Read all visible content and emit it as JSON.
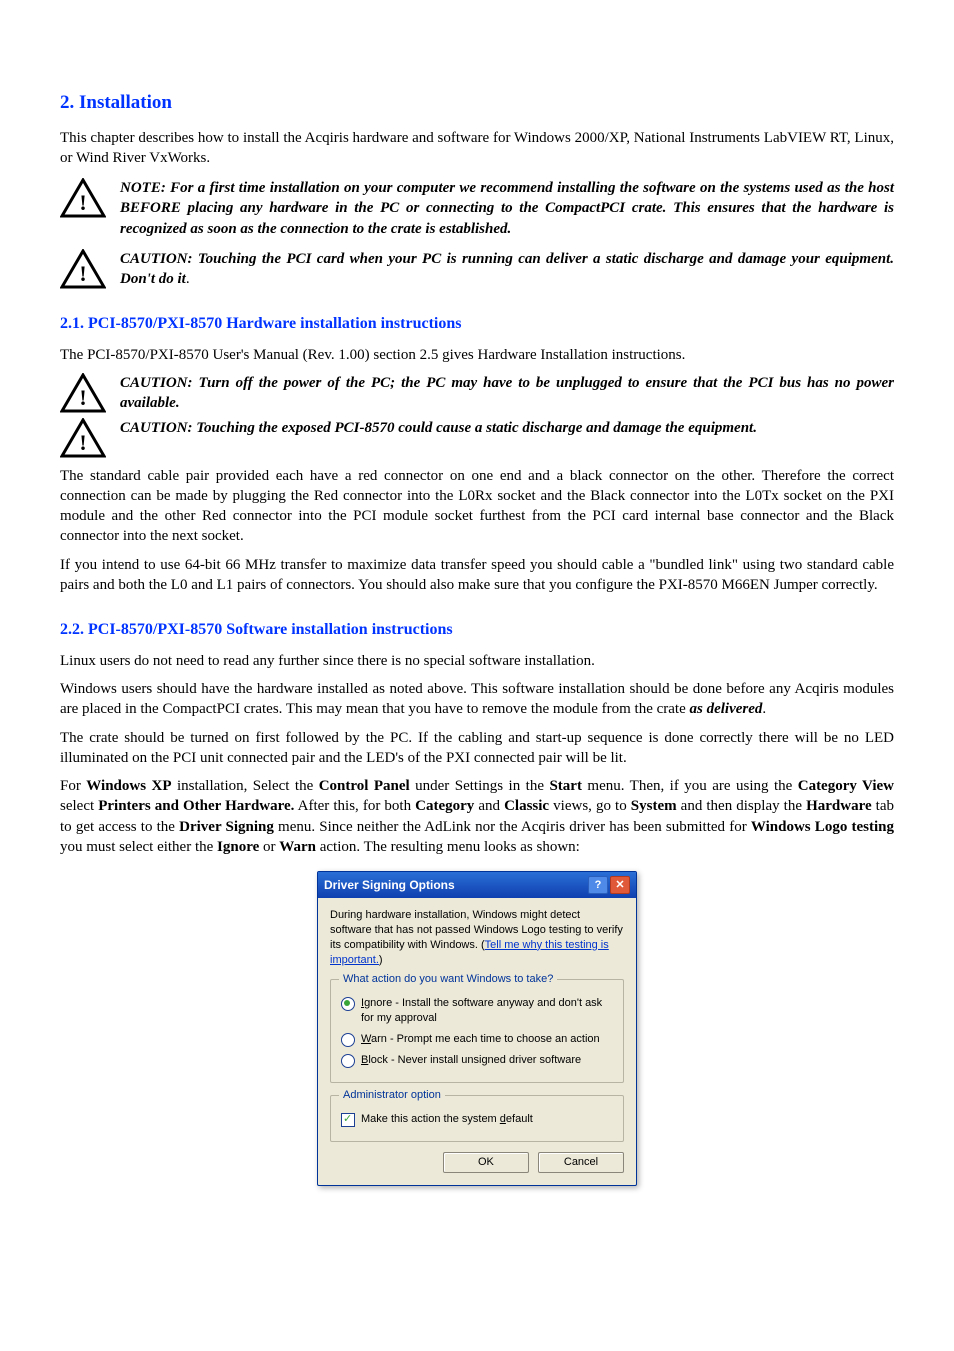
{
  "sections": {
    "s1": {
      "title": "2. Installation",
      "intro": "This chapter describes how to install the Acqiris hardware and software for Windows 2000/XP, National Instruments LabVIEW RT, Linux, or Wind River VxWorks.",
      "caution1_lead": "NOTE:",
      "caution1_body": " For a first time installation on your computer we recommend installing the software on the systems used as the host BEFORE placing any hardware in the PC or connecting to the CompactPCI crate. This ensures that the hardware is recognized as soon as the connection to the crate is established.",
      "caution2_lead": "CAUTION:",
      "caution2_body": " Touching the PCI card when your PC is running can deliver a static discharge and damage your equipment. Don't do it"
    },
    "s2": {
      "title": "2.1. PCI-8570/PXI-8570 Hardware installation instructions",
      "p1": "The PCI-8570/PXI-8570 User's Manual (Rev. 1.00) section 2.5 gives Hardware Installation instructions.",
      "caution3_lead": "CAUTION",
      "caution3_body": ": Turn off the power of the PC; the PC may have to be unplugged to ensure that the PCI bus has no power available.",
      "caution4_lead": "CAUTION:",
      "caution4_body": " Touching the exposed PCI-8570 could cause a static discharge and damage the equipment.",
      "p2": "The standard cable pair provided each have a red connector on one end and a black connector on the other. Therefore the correct connection can be made by plugging the Red connector into the L0Rx socket and the Black connector into the L0Tx socket on the PXI module and the other Red connector into the PCI module socket furthest from the PCI card internal base connector and the Black connector into the next socket.",
      "p3": "If you intend to use 64-bit 66 MHz transfer to maximize data transfer speed you should cable a \"bundled link\" using two standard cable pairs and both the L0 and L1 pairs of connectors. You should also make sure that you configure the PXI-8570 M66EN Jumper correctly."
    },
    "s3": {
      "title": "2.2. PCI-8570/PXI-8570 Software installation instructions",
      "p1": "Linux users do not need to read any further since there is no special software installation.",
      "p2a": "Windows users should have the hardware installed as noted above. This software installation should be done before any Acqiris modules are placed in the CompactPCI crates. This may mean that you have to remove the module from the crate ",
      "p2b_it": "as delivered",
      "p2c": ".",
      "p3": "The crate should be turned on first followed by the PC. If the cabling and start-up sequence is done correctly there will be no LED illuminated on the PCI unit connected pair and the LED's of the PXI connected pair will be lit.",
      "mix": {
        "a": "For ",
        "b": "Windows XP",
        "c": " installation, Select the ",
        "d": "Control Panel",
        "e": " under Settings in the ",
        "f": "Start",
        "g": " menu. Then, if you are using the ",
        "h": "Category View",
        "i": " select ",
        "j": "Printers and Other Hardware.",
        "k": " After this, for both ",
        "l": "Category",
        "m": " and ",
        "n": "Classic",
        "o": " views, go to ",
        "p": "System",
        "q": " and then display the ",
        "r": "Hardware",
        "s": " tab to get access to the ",
        "t": "Driver Signing",
        "u": " menu. Since neither the AdLink nor the Acqiris driver has been submitted for ",
        "v": "Windows Logo testing",
        "w": " you must select either the ",
        "x": "Ignore",
        "y": " or ",
        "z": "Warn",
        "aa": " action. The resulting menu looks as shown:"
      }
    }
  },
  "dialog": {
    "title": "Driver Signing Options",
    "intro_a": "During hardware installation, Windows might detect software that has not passed Windows Logo testing to verify its compatibility with Windows. (",
    "intro_link": "Tell me why this testing is important.",
    "intro_b": ")",
    "legend1": "What action do you want Windows to take?",
    "opt_ignore_u": "I",
    "opt_ignore": "gnore - Install the software anyway and don't ask for my approval",
    "opt_warn_u": "W",
    "opt_warn": "arn - Prompt me each time to choose an action",
    "opt_block_u": "B",
    "opt_block": "lock - Never install unsigned driver software",
    "legend2": "Administrator option",
    "chk_a": "Make this action the system ",
    "chk_u": "d",
    "chk_b": "efault",
    "ok": "OK",
    "cancel": "Cancel"
  }
}
